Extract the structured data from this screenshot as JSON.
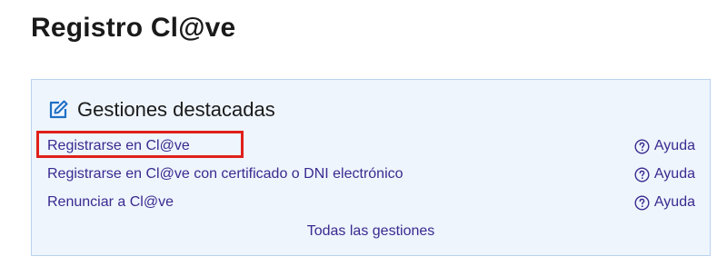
{
  "page": {
    "title": "Registro Cl@ve"
  },
  "panel": {
    "icon": "edit-icon",
    "title": "Gestiones destacadas",
    "items": [
      {
        "label": "Registrarse en Cl@ve",
        "help_label": "Ayuda",
        "highlighted": true
      },
      {
        "label": "Registrarse en Cl@ve con certificado o DNI electrónico",
        "help_label": "Ayuda",
        "highlighted": false
      },
      {
        "label": "Renunciar a Cl@ve",
        "help_label": "Ayuda",
        "highlighted": false
      }
    ],
    "all_link": "Todas las gestiones"
  },
  "colors": {
    "link": "#3a2a8f",
    "icon_blue": "#1f6fc5",
    "panel_bg": "#eef5fd",
    "panel_border": "#b9d3ef",
    "highlight": "#e0201b"
  }
}
